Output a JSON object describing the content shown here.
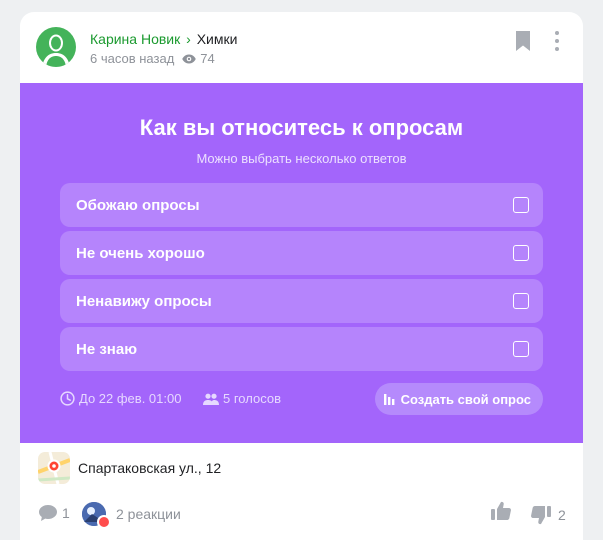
{
  "post": {
    "author": "Карина Новик",
    "separator": "›",
    "city": "Химки",
    "time": "6 часов назад",
    "views": "74"
  },
  "poll": {
    "title": "Как вы относитесь к опросам",
    "subtitle": "Можно выбрать несколько ответов",
    "options": [
      {
        "label": "Обожаю опросы",
        "checked": false
      },
      {
        "label": "Не очень хорошо",
        "checked": false
      },
      {
        "label": "Ненавижу опросы",
        "checked": false
      },
      {
        "label": "Не знаю",
        "checked": false
      }
    ],
    "deadline": "До 22 фев. 01:00",
    "votes": "5 голосов",
    "create_label": "Создать свой опрос"
  },
  "location": {
    "address": "Спартаковская ул., 12"
  },
  "actions": {
    "comments_count": "1",
    "reactions_label": "2 реакции",
    "dislike_count": "2"
  },
  "colors": {
    "poll_bg": "#a365fb",
    "author_green": "#1b9a2f",
    "icon_gray": "#8e9299"
  },
  "icons": [
    "avatar-silhouette",
    "eye-icon",
    "bookmark-icon",
    "more-vertical-icon",
    "clock-icon",
    "people-icon",
    "bar-chart-icon",
    "map-pin-icon",
    "comment-icon",
    "like-icon",
    "dislike-icon"
  ]
}
